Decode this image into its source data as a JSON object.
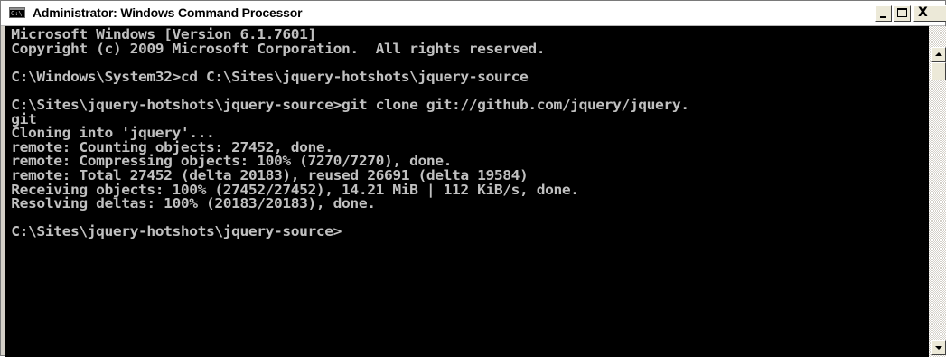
{
  "window": {
    "title": "Administrator: Windows Command Processor",
    "icon_label": "C:\\",
    "icon": "cmd-icon",
    "controls": {
      "minimize": "minimize-icon",
      "maximize": "maximize-icon",
      "close": "close-icon",
      "close_glyph": "X"
    }
  },
  "console": {
    "background_color": "#000000",
    "text_color": "#c0c0c0",
    "lines": [
      "Microsoft Windows [Version 6.1.7601]",
      "Copyright (c) 2009 Microsoft Corporation.  All rights reserved.",
      "",
      "C:\\Windows\\System32>cd C:\\Sites\\jquery-hotshots\\jquery-source",
      "",
      "C:\\Sites\\jquery-hotshots\\jquery-source>git clone git://github.com/jquery/jquery.",
      "git",
      "Cloning into 'jquery'...",
      "remote: Counting objects: 27452, done.",
      "remote: Compressing objects: 100% (7270/7270), done.",
      "remote: Total 27452 (delta 20183), reused 26691 (delta 19584)",
      "Receiving objects: 100% (27452/27452), 14.21 MiB | 112 KiB/s, done.",
      "Resolving deltas: 100% (20183/20183), done.",
      "",
      "C:\\Sites\\jquery-hotshots\\jquery-source>"
    ]
  },
  "scrollbar": {
    "up_icon": "scroll-up-icon",
    "down_icon": "scroll-down-icon"
  }
}
